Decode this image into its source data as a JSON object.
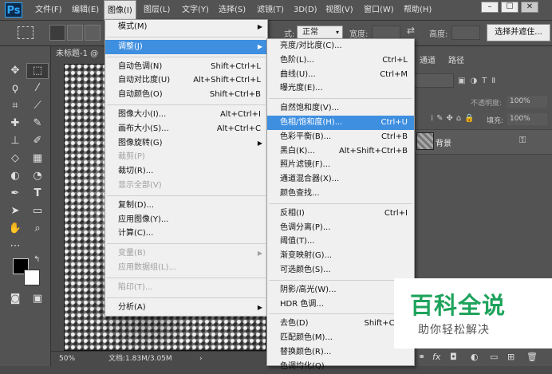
{
  "app": {
    "logo": "Ps"
  },
  "menubar": {
    "items": [
      "文件(F)",
      "编辑(E)",
      "图像(I)",
      "图层(L)",
      "文字(Y)",
      "选择(S)",
      "滤镜(T)",
      "3D(D)",
      "视图(V)",
      "窗口(W)",
      "帮助(H)"
    ],
    "active_index": 2
  },
  "window_controls": {
    "minimize": "–",
    "maximize": "☐",
    "close": "✕"
  },
  "options": {
    "style_label": "式:",
    "style_value": "正常",
    "width_label": "宽度:",
    "height_label": "高度:",
    "select_and_mask": "选择并遮住..."
  },
  "document": {
    "tab_title": "未标题-1 @",
    "zoom": "50%",
    "doc_info": "文档:1.83M/3.05M"
  },
  "panels": {
    "tabs": [
      "通道",
      "路径"
    ],
    "opacity_label": "不透明度:",
    "opacity_value": "100%",
    "fill_label": "填充:",
    "fill_value": "100%",
    "layer_name": "背景"
  },
  "image_menu": [
    {
      "type": "item",
      "label": "模式(M)",
      "submenu": true
    },
    {
      "type": "sep"
    },
    {
      "type": "item",
      "label": "调整(J)",
      "submenu": true,
      "highlight": true
    },
    {
      "type": "sep"
    },
    {
      "type": "item",
      "label": "自动色调(N)",
      "shortcut": "Shift+Ctrl+L"
    },
    {
      "type": "item",
      "label": "自动对比度(U)",
      "shortcut": "Alt+Shift+Ctrl+L"
    },
    {
      "type": "item",
      "label": "自动颜色(O)",
      "shortcut": "Shift+Ctrl+B"
    },
    {
      "type": "sep"
    },
    {
      "type": "item",
      "label": "图像大小(I)...",
      "shortcut": "Alt+Ctrl+I"
    },
    {
      "type": "item",
      "label": "画布大小(S)...",
      "shortcut": "Alt+Ctrl+C"
    },
    {
      "type": "item",
      "label": "图像旋转(G)",
      "submenu": true
    },
    {
      "type": "item",
      "label": "裁剪(P)",
      "disabled": true
    },
    {
      "type": "item",
      "label": "裁切(R)..."
    },
    {
      "type": "item",
      "label": "显示全部(V)",
      "disabled": true
    },
    {
      "type": "sep"
    },
    {
      "type": "item",
      "label": "复制(D)..."
    },
    {
      "type": "item",
      "label": "应用图像(Y)..."
    },
    {
      "type": "item",
      "label": "计算(C)..."
    },
    {
      "type": "sep"
    },
    {
      "type": "item",
      "label": "变量(B)",
      "submenu": true,
      "disabled": true
    },
    {
      "type": "item",
      "label": "应用数据组(L)...",
      "disabled": true
    },
    {
      "type": "sep"
    },
    {
      "type": "item",
      "label": "陷印(T)...",
      "disabled": true
    },
    {
      "type": "sep"
    },
    {
      "type": "item",
      "label": "分析(A)",
      "submenu": true
    }
  ],
  "adjust_menu": [
    {
      "type": "item",
      "label": "亮度/对比度(C)..."
    },
    {
      "type": "item",
      "label": "色阶(L)...",
      "shortcut": "Ctrl+L"
    },
    {
      "type": "item",
      "label": "曲线(U)...",
      "shortcut": "Ctrl+M"
    },
    {
      "type": "item",
      "label": "曝光度(E)..."
    },
    {
      "type": "sep"
    },
    {
      "type": "item",
      "label": "自然饱和度(V)..."
    },
    {
      "type": "item",
      "label": "色相/饱和度(H)...",
      "shortcut": "Ctrl+U",
      "highlight": true
    },
    {
      "type": "item",
      "label": "色彩平衡(B)...",
      "shortcut": "Ctrl+B"
    },
    {
      "type": "item",
      "label": "黑白(K)...",
      "shortcut": "Alt+Shift+Ctrl+B"
    },
    {
      "type": "item",
      "label": "照片滤镜(F)..."
    },
    {
      "type": "item",
      "label": "通道混合器(X)..."
    },
    {
      "type": "item",
      "label": "颜色查找..."
    },
    {
      "type": "sep"
    },
    {
      "type": "item",
      "label": "反相(I)",
      "shortcut": "Ctrl+I"
    },
    {
      "type": "item",
      "label": "色调分离(P)..."
    },
    {
      "type": "item",
      "label": "阈值(T)..."
    },
    {
      "type": "item",
      "label": "渐变映射(G)..."
    },
    {
      "type": "item",
      "label": "可选颜色(S)..."
    },
    {
      "type": "sep"
    },
    {
      "type": "item",
      "label": "阴影/高光(W)..."
    },
    {
      "type": "item",
      "label": "HDR 色调..."
    },
    {
      "type": "sep"
    },
    {
      "type": "item",
      "label": "去色(D)",
      "shortcut": "Shift+Ctr+"
    },
    {
      "type": "item",
      "label": "匹配颜色(M)..."
    },
    {
      "type": "item",
      "label": "替换颜色(R)..."
    },
    {
      "type": "item",
      "label": "色调均化(Q)"
    }
  ],
  "watermark": {
    "title": "百科全说",
    "subtitle": "助你轻松解决"
  },
  "tools": [
    "move-icon",
    "marquee-icon",
    "lasso-icon",
    "magic-wand-icon",
    "crop-icon",
    "eyedropper-icon",
    "healing-icon",
    "brush-icon",
    "stamp-icon",
    "history-brush-icon",
    "eraser-icon",
    "gradient-icon",
    "blur-icon",
    "dodge-icon",
    "pen-icon",
    "text-icon",
    "path-select-icon",
    "shape-icon",
    "hand-icon",
    "zoom-icon",
    "more-icon"
  ],
  "colors": {
    "highlight": "#3f8fe0",
    "watermark_green": "#1ea35c"
  }
}
